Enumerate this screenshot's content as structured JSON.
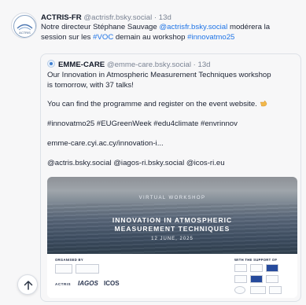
{
  "post": {
    "author_name": "ACTRIS-FR",
    "author_handle": "@actrisfr.bsky.social",
    "separator": "·",
    "time": "13d",
    "text_line1_pre": "Notre directeur Stéphane Sauvage ",
    "text_mention": "@actrisfr.bsky.social",
    "text_line1_post": " modérera la",
    "text_line2_pre": "session sur les ",
    "hashtag_voc": "#VOC",
    "text_line2_mid": " demain au workshop ",
    "hashtag_innovatmo": "#innovatmo25"
  },
  "quoted": {
    "author_name": "EMME-CARE",
    "author_handle": "@emme-care.bsky.social",
    "separator": "·",
    "time": "13d",
    "line1": "Our Innovation in Atmospheric Measurement Techniques workshop",
    "line2": "is tomorrow, with 37 talks!",
    "line3": "You can find the programme and register on the event website.",
    "hashtags": "#innovatmo25 #EUGreenWeek #edu4climate #envrinnov",
    "link": "emme-care.cyi.ac.cy/innovation-i...",
    "mentions": "@actris.bsky.social @iagos-ri.bsky.social @icos-ri.eu"
  },
  "image": {
    "label": "VIRTUAL WORKSHOP",
    "title_line1": "INNOVATION IN ATMOSPHERIC",
    "title_line2": "MEASUREMENT TECHNIQUES",
    "date": "12 JUNE, 2025",
    "organised_by": "ORGANISED BY",
    "support": "WITH THE SUPPORT OF",
    "logo_iagos": "IAGOS",
    "logo_icos": "ICOS",
    "logo_actris": "ACTRIS"
  },
  "colors": {
    "link": "#1f74e6",
    "text": "#1c2333",
    "muted": "#7b8494",
    "background": "#f7f7f8"
  },
  "icons": {
    "scroll_top": "arrow-up-icon",
    "hand": "pointing-hand-emoji"
  }
}
